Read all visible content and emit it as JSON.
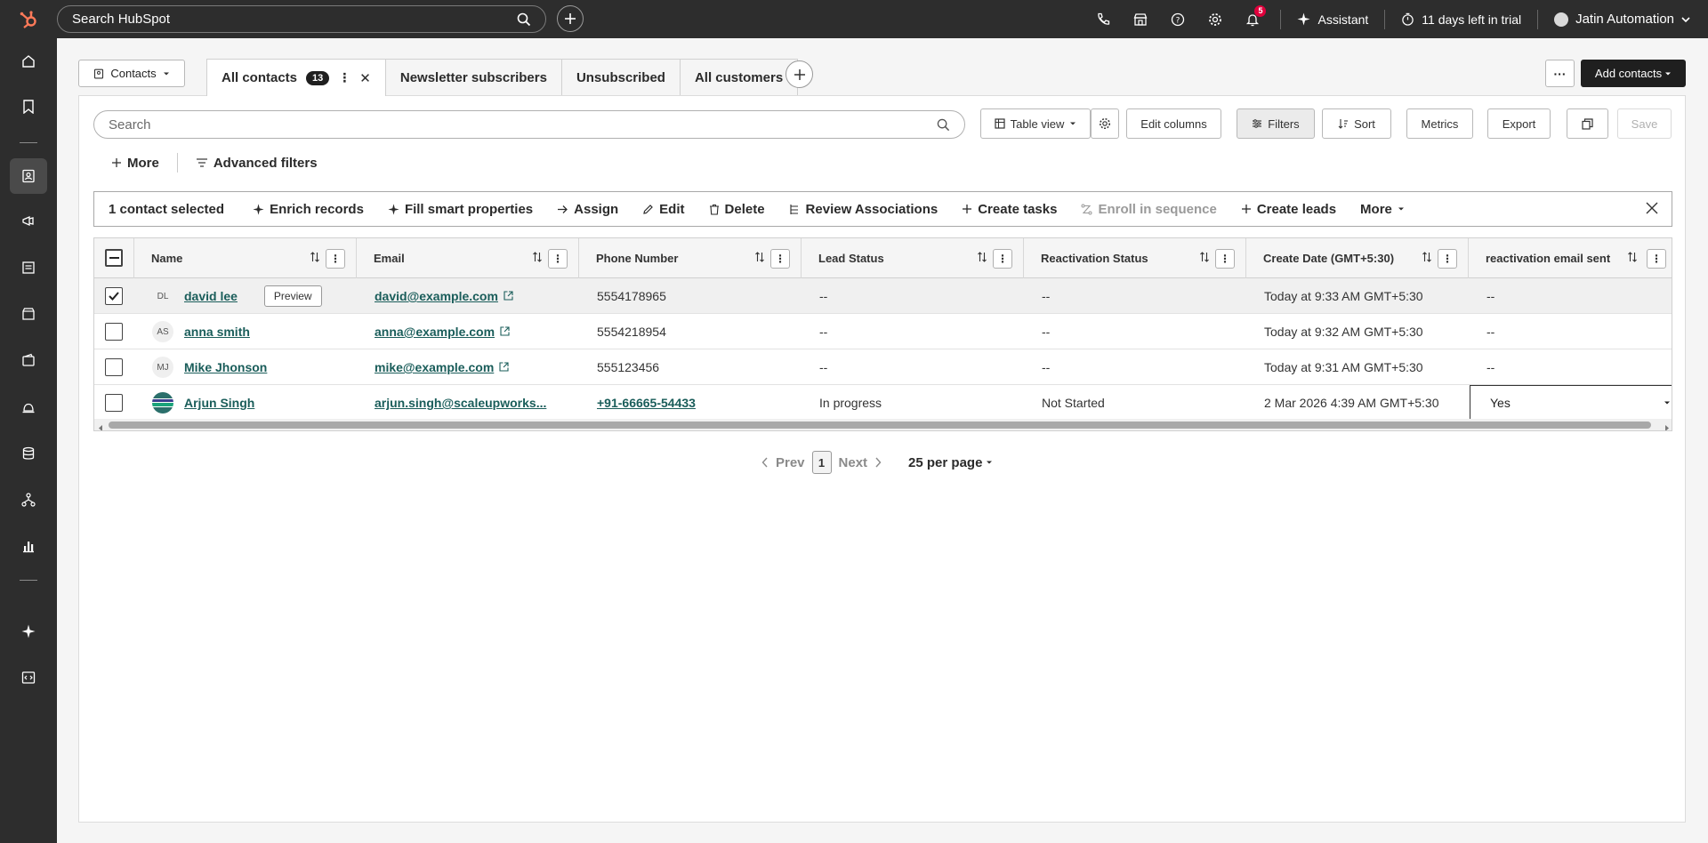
{
  "topbar": {
    "search_placeholder": "Search HubSpot",
    "notifications_count": "5",
    "assistant_label": "Assistant",
    "trial_label": "11 days left in trial",
    "user_name": "Jatin Automation"
  },
  "header": {
    "object_selector": "Contacts",
    "tabs": [
      {
        "label": "All contacts",
        "count": "13"
      },
      {
        "label": "Newsletter subscribers"
      },
      {
        "label": "Unsubscribed"
      },
      {
        "label": "All customers"
      }
    ],
    "add_contacts_label": "Add contacts"
  },
  "toolbar": {
    "search_placeholder": "Search",
    "table_view": "Table view",
    "edit_columns": "Edit columns",
    "filters": "Filters",
    "sort": "Sort",
    "metrics": "Metrics",
    "export": "Export",
    "save": "Save"
  },
  "filters_row": {
    "more": "More",
    "advanced_filters": "Advanced filters"
  },
  "bulk": {
    "selected_label": "1 contact selected",
    "actions": [
      "Enrich records",
      "Fill smart properties",
      "Assign",
      "Edit",
      "Delete",
      "Review Associations",
      "Create tasks",
      "Enroll in sequence",
      "Create leads",
      "More"
    ]
  },
  "table": {
    "columns": [
      "Name",
      "Email",
      "Phone Number",
      "Lead Status",
      "Reactivation Status",
      "Create Date (GMT+5:30)",
      "reactivation email sent"
    ],
    "preview_label": "Preview",
    "rows": [
      {
        "initials": "DL",
        "name": "david lee",
        "email": "david@example.com",
        "phone": "5554178965",
        "lead_status": "--",
        "reactivation_status": "--",
        "create_date": "Today at 9:33 AM GMT+5:30",
        "reactivation_email_sent": "--",
        "selected": true
      },
      {
        "initials": "AS",
        "name": "anna smith",
        "email": "anna@example.com",
        "phone": "5554218954",
        "lead_status": "--",
        "reactivation_status": "--",
        "create_date": "Today at 9:32 AM GMT+5:30",
        "reactivation_email_sent": "--",
        "selected": false
      },
      {
        "initials": "MJ",
        "name": "Mike Jhonson",
        "email": "mike@example.com",
        "phone": "555123456",
        "lead_status": "--",
        "reactivation_status": "--",
        "create_date": "Today at 9:31 AM GMT+5:30",
        "reactivation_email_sent": "--",
        "selected": false
      },
      {
        "initials": "",
        "name": "Arjun Singh",
        "email": "arjun.singh@scaleupworks...",
        "phone": "+91-66665-54433",
        "lead_status": "In progress",
        "reactivation_status": "Not Started",
        "create_date": "2 Mar 2026 4:39 AM GMT+5:30",
        "reactivation_email_sent": "Yes",
        "selected": false
      }
    ]
  },
  "pagination": {
    "prev": "Prev",
    "current": "1",
    "next": "Next",
    "per_page": "25 per page"
  }
}
